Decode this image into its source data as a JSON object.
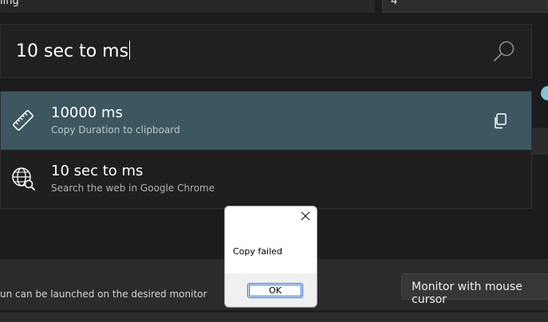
{
  "background": {
    "top_label": "ling",
    "top_input_value": "4",
    "monitor_description": "un can be launched on the desired monitor",
    "monitor_dropdown_value": "Monitor with mouse cursor"
  },
  "launcher": {
    "query": "10 sec to ms",
    "results": [
      {
        "title": "10000 ms",
        "subtitle": "Copy Duration to clipboard",
        "icon": "ruler-icon",
        "action_icon": "copy-icon"
      },
      {
        "title": "10 sec to ms",
        "subtitle": "Search the web in Google Chrome",
        "icon": "globe-search-icon"
      }
    ]
  },
  "dialog": {
    "message": "Copy failed",
    "ok_label": "OK",
    "close_icon": "close-icon"
  },
  "colors": {
    "selected_row": "#3c5760",
    "accent": "#2b6fd6"
  }
}
